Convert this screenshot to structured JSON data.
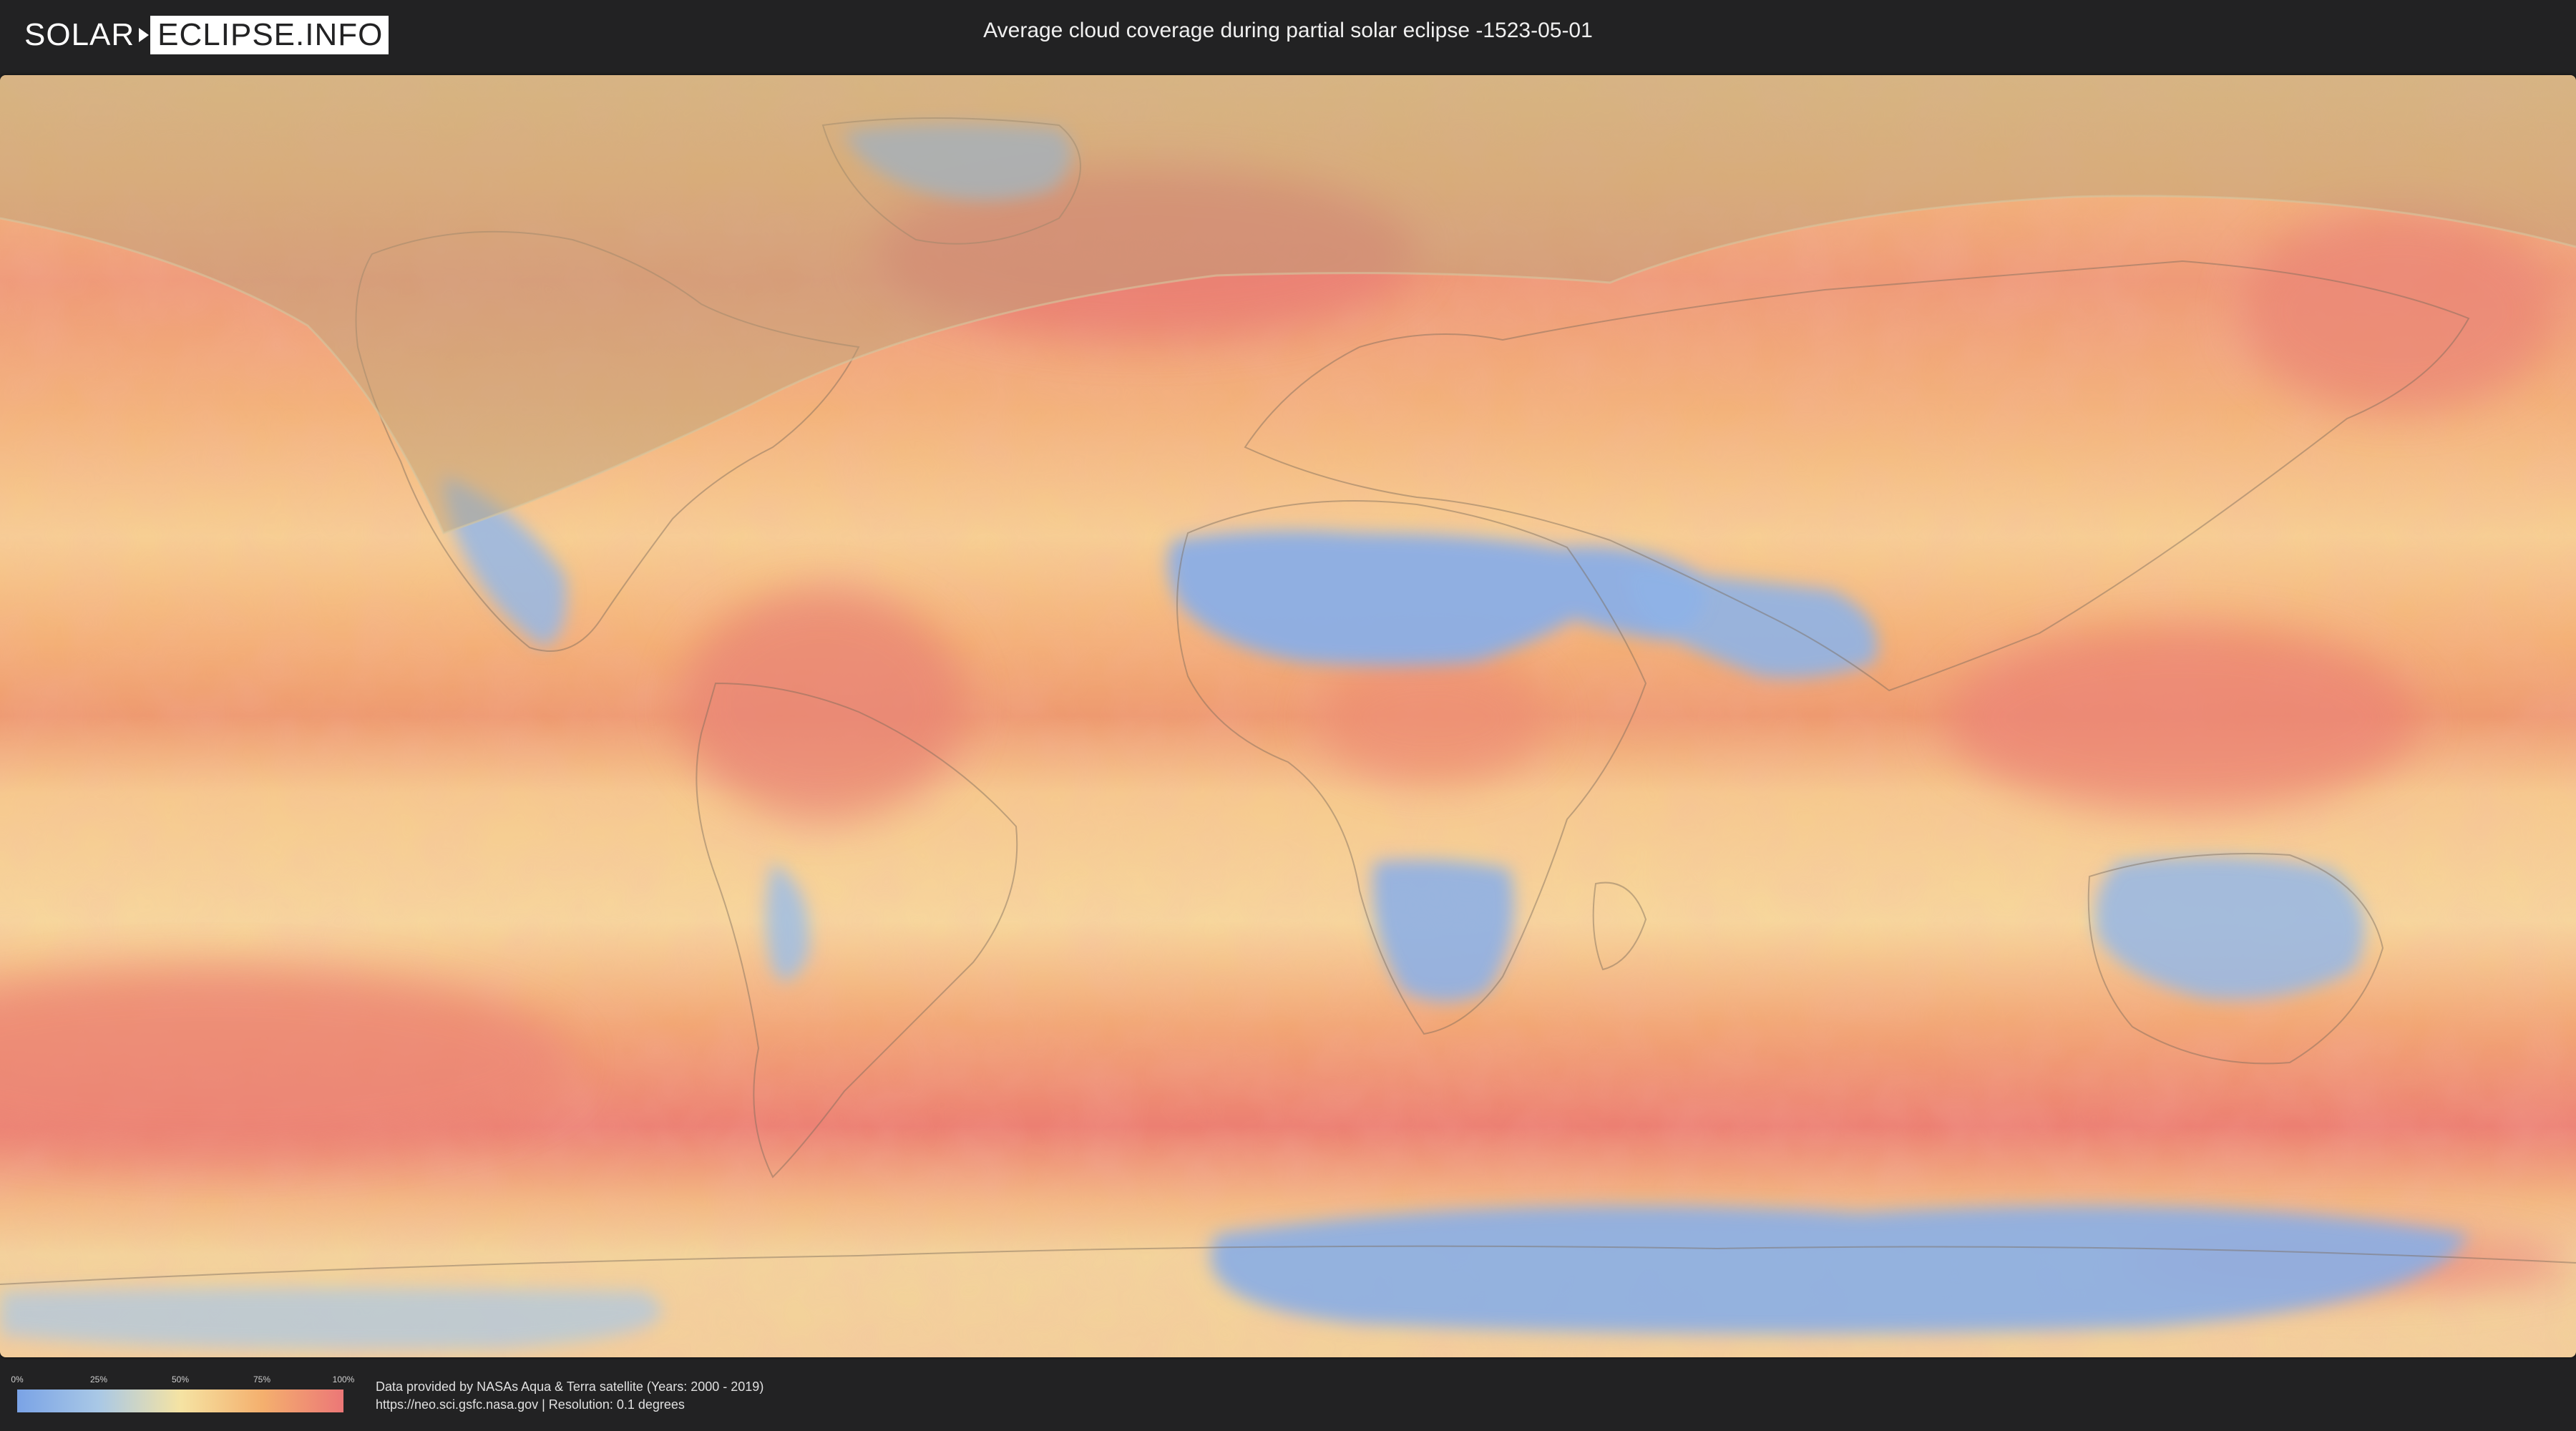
{
  "header": {
    "logo_left": "SOLAR",
    "logo_right": "ECLIPSE.INFO",
    "title": "Average cloud coverage during partial solar eclipse -1523-05-01"
  },
  "legend": {
    "ticks": [
      "0%",
      "25%",
      "50%",
      "75%",
      "100%"
    ],
    "colors": [
      "#7aa3e6",
      "#a9c8e6",
      "#f5e3a3",
      "#f4b06e",
      "#ec7777"
    ]
  },
  "footer": {
    "line1": "Data provided by NASAs Aqua & Terra satellite (Years: 2000 - 2019)",
    "line2": "https://neo.sci.gsfc.nasa.gov | Resolution: 0.1 degrees"
  },
  "map": {
    "land_blue_regions": [
      "greenland-interior",
      "sahara",
      "arabia",
      "australia",
      "southern-africa",
      "antarctica"
    ],
    "eclipse_overlay_color": "#b8a27a"
  }
}
